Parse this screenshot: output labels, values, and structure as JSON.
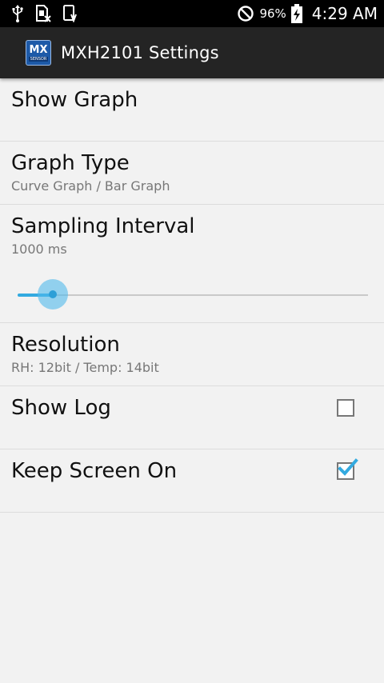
{
  "status_bar": {
    "icons_left": [
      "usb-icon",
      "sim-error-icon",
      "download-icon"
    ],
    "dnd_icon": "do-not-disturb-icon",
    "battery_percent": "96%",
    "battery_icon": "battery-charging-icon",
    "time": "4:29 AM"
  },
  "app_bar": {
    "logo_text": "MX",
    "logo_subtext": "SENSOR",
    "title": "MXH2101 Settings"
  },
  "settings": {
    "show_graph": {
      "title": "Show Graph"
    },
    "graph_type": {
      "title": "Graph Type",
      "summary": "Curve Graph / Bar Graph"
    },
    "sampling_interval": {
      "title": "Sampling Interval",
      "summary": "1000 ms",
      "slider_value": 0.1
    },
    "resolution": {
      "title": "Resolution",
      "summary": "RH: 12bit / Temp: 14bit"
    },
    "show_log": {
      "title": "Show Log",
      "checked": false
    },
    "keep_screen_on": {
      "title": "Keep Screen On",
      "checked": true
    }
  },
  "colors": {
    "accent": "#33aae0",
    "action_bar": "#242424",
    "status_bar": "#000000",
    "background": "#f2f2f2"
  }
}
